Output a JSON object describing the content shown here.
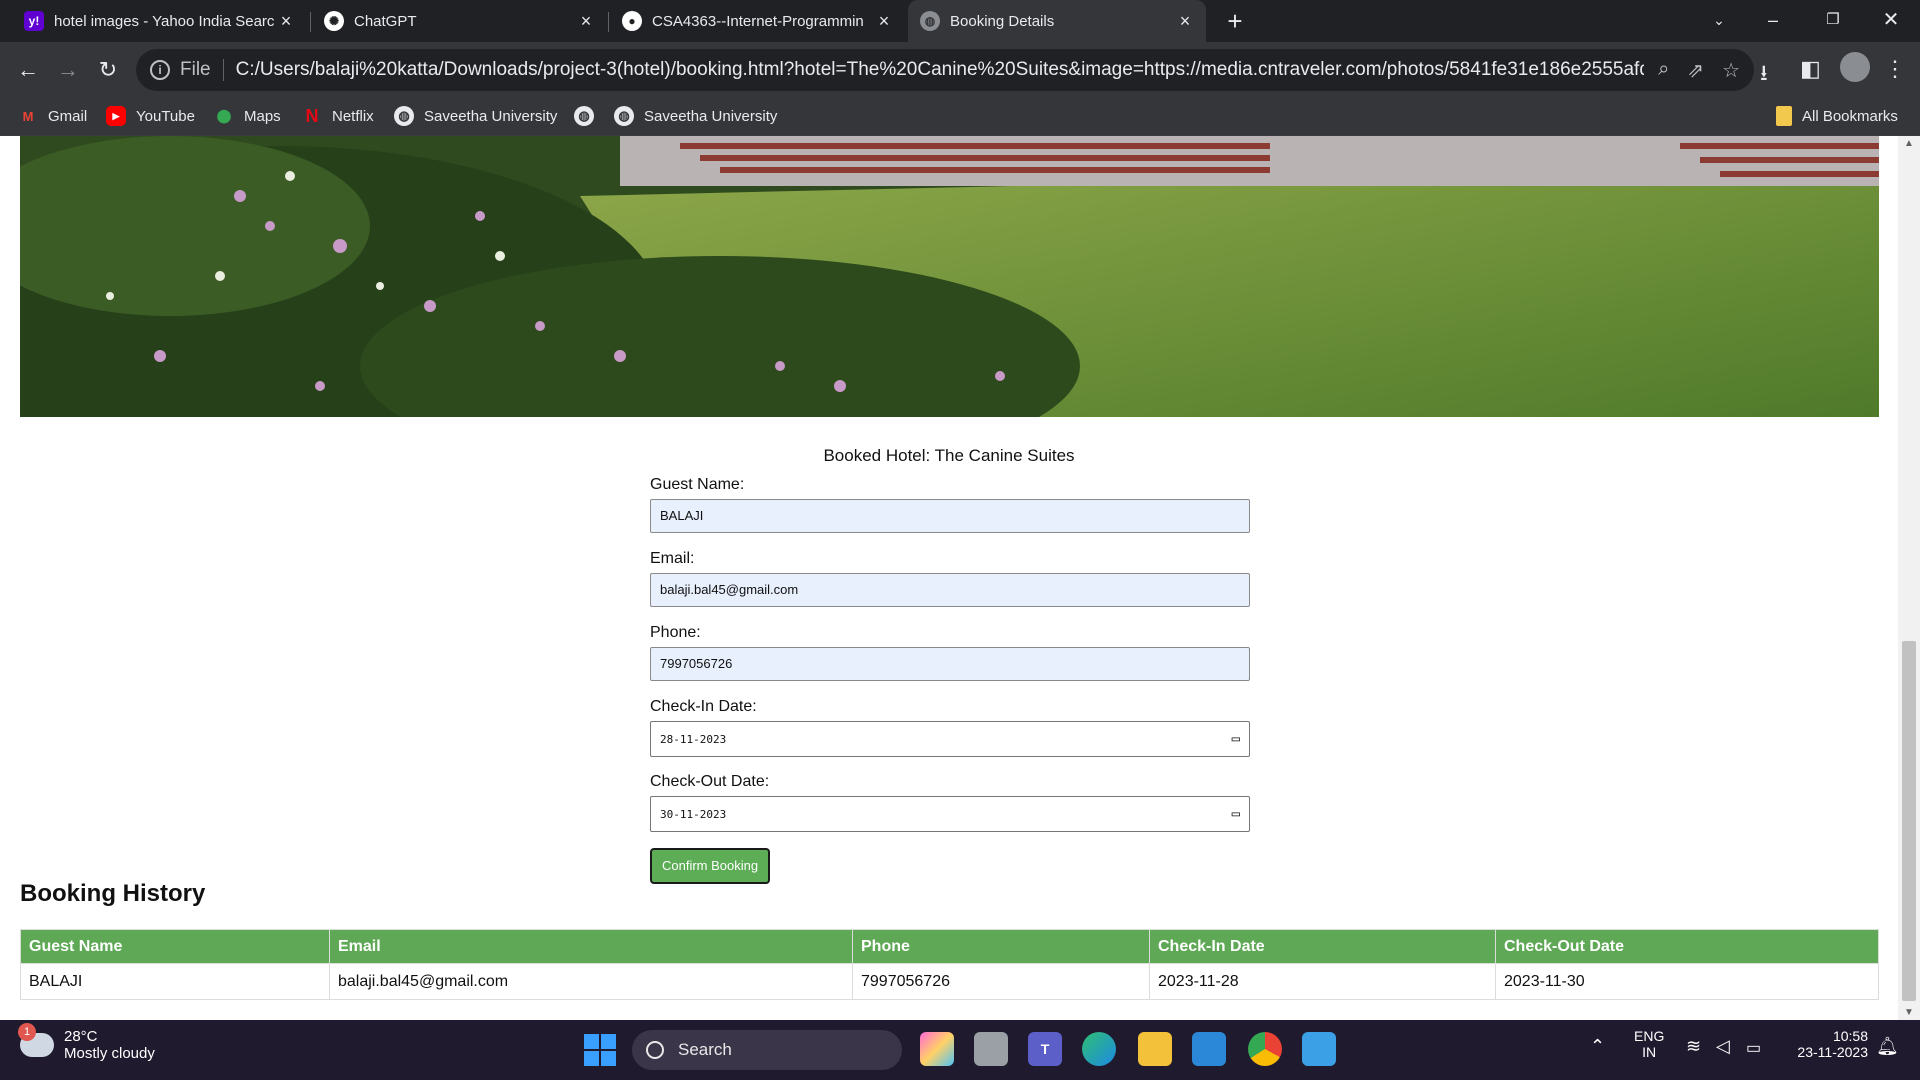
{
  "browser": {
    "tabs": [
      {
        "title": "hotel images - Yahoo India Searc",
        "icon": "yahoo-icon",
        "active": false
      },
      {
        "title": "ChatGPT",
        "icon": "chatgpt-icon",
        "active": false
      },
      {
        "title": "CSA4363--Internet-Programmin",
        "icon": "github-icon",
        "active": false
      },
      {
        "title": "Booking Details",
        "icon": "globe-icon",
        "active": true
      }
    ],
    "address": {
      "scheme_label": "File",
      "url": "C:/Users/balaji%20katta/Downloads/project-3(hotel)/booking.html?hotel=The%20Canine%20Suites&image=https://media.cntraveler.com/photos/5841fe31e186e2555afdd5ca/ma..."
    },
    "bookmarks": [
      {
        "label": "Gmail",
        "icon": "gmail-icon"
      },
      {
        "label": "YouTube",
        "icon": "youtube-icon"
      },
      {
        "label": "Maps",
        "icon": "maps-icon"
      },
      {
        "label": "Netflix",
        "icon": "netflix-icon"
      },
      {
        "label": "Saveetha University",
        "icon": "globe-icon"
      },
      {
        "label": "",
        "icon": "globe-icon"
      },
      {
        "label": "Saveetha University",
        "icon": "globe-icon"
      }
    ],
    "all_bookmarks_label": "All Bookmarks"
  },
  "page": {
    "booked_hotel_text": "Booked Hotel: The Canine Suites",
    "form": {
      "guest_name_label": "Guest Name:",
      "guest_name_value": "BALAJI",
      "email_label": "Email:",
      "email_value": "balaji.bal45@gmail.com",
      "phone_label": "Phone:",
      "phone_value": "7997056726",
      "checkin_label": "Check-In Date:",
      "checkin_value": "28-11-2023",
      "checkout_label": "Check-Out Date:",
      "checkout_value": "30-11-2023",
      "confirm_label": "Confirm Booking"
    },
    "history": {
      "title": "Booking History",
      "columns": [
        "Guest Name",
        "Email",
        "Phone",
        "Check-In Date",
        "Check-Out Date"
      ],
      "rows": [
        [
          "BALAJI",
          "balaji.bal45@gmail.com",
          "7997056726",
          "2023-11-28",
          "2023-11-30"
        ]
      ]
    }
  },
  "taskbar": {
    "weather_badge": "1",
    "temperature": "28°C",
    "condition": "Mostly cloudy",
    "search_label": "Search",
    "language_top": "ENG",
    "language_bottom": "IN",
    "time": "10:58",
    "date": "23-11-2023"
  },
  "colors": {
    "accent_green": "#5fa956",
    "chrome_dark": "#202124",
    "chrome_toolbar": "#35363a"
  }
}
